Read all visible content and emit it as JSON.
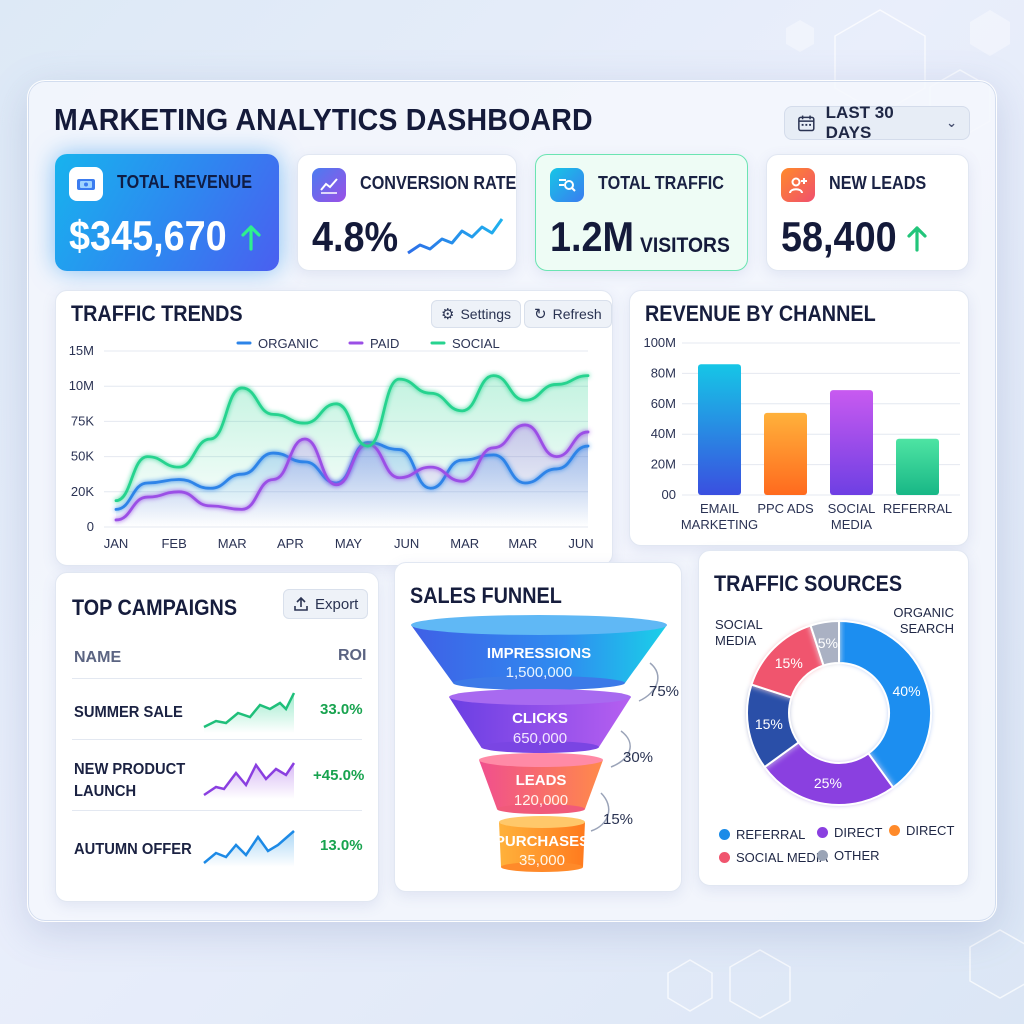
{
  "header": {
    "title": "MARKETING ANALYTICS DASHBOARD",
    "date_range": "LAST 30 DAYS",
    "calendar_icon": "calendar-icon",
    "chevron_icon": "chevron-down-icon"
  },
  "kpis": [
    {
      "label": "TOTAL REVENUE",
      "value": "$345,670",
      "icon": "revenue-icon",
      "trend": "up"
    },
    {
      "label": "CONVERSION RATE",
      "value": "4.8%",
      "icon": "line-chart-icon"
    },
    {
      "label": "TOTAL TRAFFIC",
      "value": "1.2M",
      "unit": "VISITORS",
      "icon": "search-analytics-icon"
    },
    {
      "label": "NEW LEADS",
      "value": "58,400",
      "icon": "add-user-icon",
      "trend": "up"
    }
  ],
  "traffic_trends": {
    "title": "TRAFFIC TRENDS",
    "settings_label": "Settings",
    "refresh_label": "Refresh"
  },
  "revenue_by_channel": {
    "title": "REVENUE BY CHANNEL"
  },
  "top_campaigns": {
    "title": "TOP CAMPAIGNS",
    "export_label": "Export",
    "col_name": "NAME",
    "col_roi": "ROI",
    "rows": [
      {
        "name": "SUMMER SALE",
        "roi": "33.0%"
      },
      {
        "name": "NEW PRODUCT\nLAUNCH",
        "roi": "+45.0%"
      },
      {
        "name": "AUTUMN OFFER",
        "roi": "13.0%"
      }
    ]
  },
  "sales_funnel": {
    "title": "SALES FUNNEL",
    "stages": [
      {
        "label": "IMPRESSIONS",
        "value": "1,500,000"
      },
      {
        "label": "CLICKS",
        "value": "650,000"
      },
      {
        "label": "LEADS",
        "value": "120,000"
      },
      {
        "label": "PURCHASES",
        "value": "35,000"
      }
    ],
    "rates": [
      "75%",
      "30%",
      "15%"
    ]
  },
  "traffic_sources": {
    "title": "TRAFFIC SOURCES",
    "callout_left": "SOCIAL\nMEDIA",
    "callout_right": "ORGANIC\nSEARCH",
    "legend": [
      {
        "label": "REFERRAL",
        "color": "#1a8be8"
      },
      {
        "label": "DIRECT",
        "color": "#8a3fe0"
      },
      {
        "label": "DIRECT",
        "color": "#ff8a2a"
      },
      {
        "label": "SOCIAL MEDIA",
        "color": "#f0556e"
      },
      {
        "label": "OTHER",
        "color": "#9aa4b6"
      }
    ]
  },
  "chart_data": [
    {
      "type": "line",
      "title": "TRAFFIC TRENDS",
      "x": [
        "JAN",
        "FEB",
        "MAR",
        "APR",
        "MAY",
        "JUN",
        "MAR",
        "MAR",
        "JUN"
      ],
      "y_ticks": [
        "0",
        "20K",
        "50K",
        "75K",
        "10M",
        "15M"
      ],
      "legend_position": "top",
      "grid": true,
      "series": [
        {
          "name": "ORGANIC",
          "color": "#2d84e8",
          "values": [
            1,
            2.5,
            2.7,
            2.2,
            3.0,
            4.2,
            3.7,
            2.5,
            4.8,
            4.4,
            2.2,
            3.8,
            4.1,
            2.5,
            3.3,
            4.6
          ]
        },
        {
          "name": "PAID",
          "color": "#9b4fe6",
          "values": [
            0.4,
            1.7,
            2.0,
            1.2,
            1.0,
            2.7,
            5.0,
            2.4,
            4.7,
            2.8,
            3.4,
            2.6,
            4.5,
            5.8,
            4.0,
            5.4
          ]
        },
        {
          "name": "SOCIAL",
          "color": "#27d38f",
          "values": [
            1.5,
            4.0,
            3.4,
            5.0,
            7.9,
            6.4,
            5.9,
            7.0,
            4.6,
            8.4,
            7.6,
            6.6,
            8.6,
            7.2,
            8.1,
            8.6
          ]
        }
      ]
    },
    {
      "type": "bar",
      "title": "REVENUE BY CHANNEL",
      "categories": [
        "EMAIL\nMARKETING",
        "PPC ADS",
        "SOCIAL\nMEDIA",
        "REFERRAL"
      ],
      "values": [
        86,
        54,
        69,
        37
      ],
      "y_ticks": [
        "00",
        "20M",
        "40M",
        "60M",
        "80M",
        "100M"
      ],
      "ylim": [
        0,
        100
      ],
      "colors": [
        [
          "#16c6e6",
          "#3a4fe0"
        ],
        [
          "#ffb13b",
          "#ff6a1e"
        ],
        [
          "#c85af0",
          "#6e3fe3"
        ],
        [
          "#4ee4a3",
          "#18b786"
        ]
      ]
    },
    {
      "type": "pie",
      "title": "TRAFFIC SOURCES",
      "slices": [
        {
          "label": "40%",
          "value": 40,
          "color": "#1d8ef0"
        },
        {
          "label": "25%",
          "value": 25,
          "color": "#8a3fe0"
        },
        {
          "label": "15%",
          "value": 15,
          "color": "#2a4fa8"
        },
        {
          "label": "15%",
          "value": 15,
          "color": "#f0556e"
        },
        {
          "label": "5%",
          "value": 5,
          "color": "#aab1c3"
        }
      ]
    }
  ]
}
